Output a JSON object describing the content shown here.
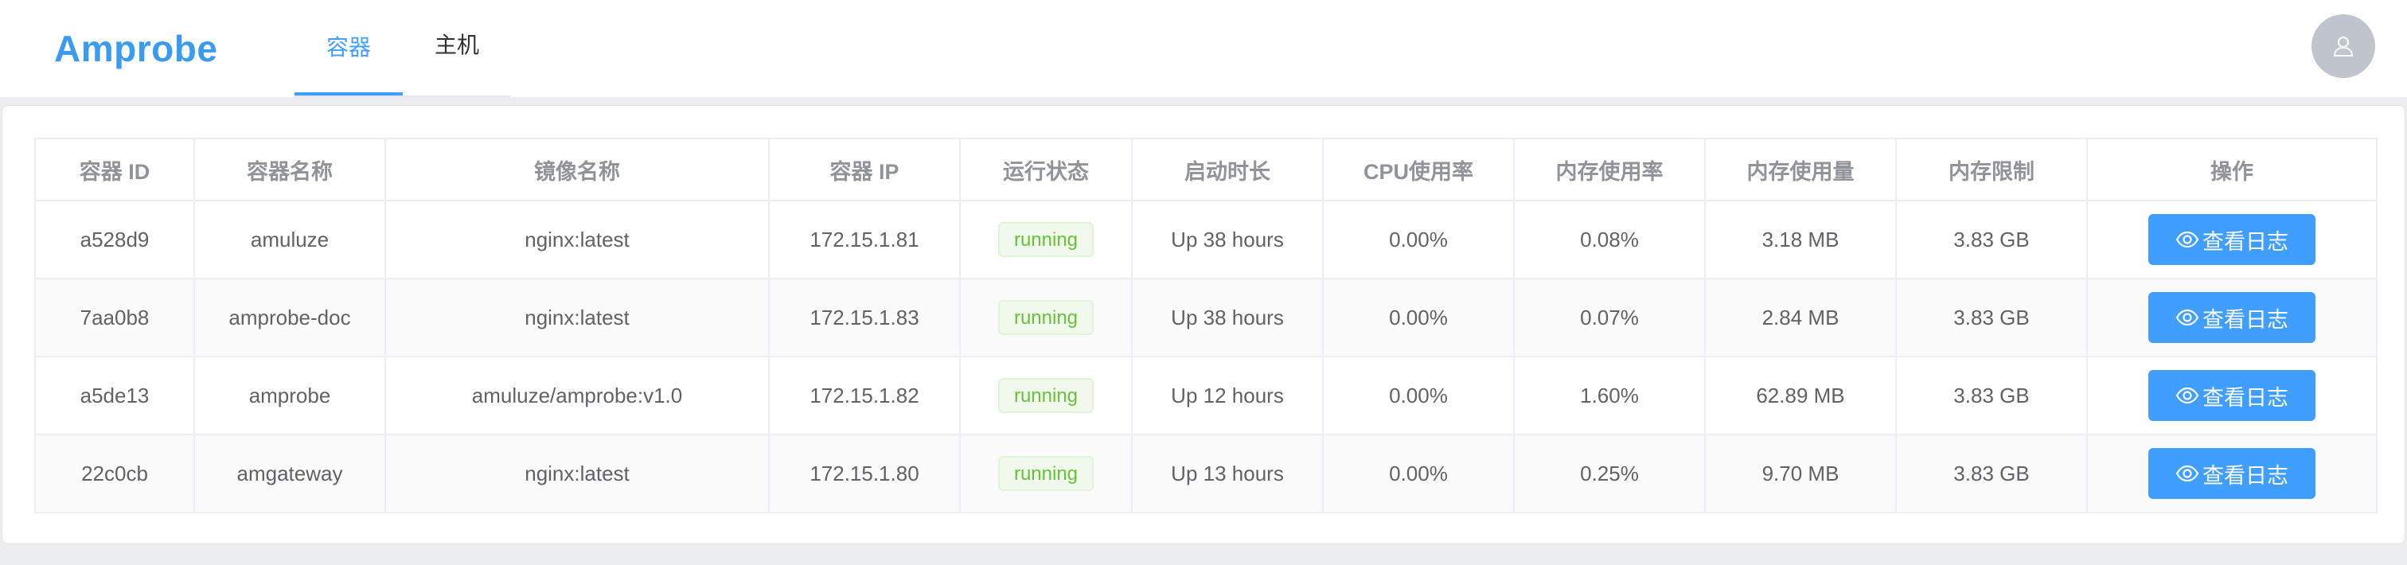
{
  "app": {
    "logo": "Amprobe"
  },
  "nav": {
    "tabs": [
      {
        "label": "容器",
        "active": true
      },
      {
        "label": "主机",
        "active": false
      }
    ]
  },
  "user": {
    "avatar_icon": "user-icon"
  },
  "table": {
    "headers": [
      "容器 ID",
      "容器名称",
      "镜像名称",
      "容器 IP",
      "运行状态",
      "启动时长",
      "CPU使用率",
      "内存使用率",
      "内存使用量",
      "内存限制",
      "操作"
    ],
    "rows": [
      {
        "id": "a528d9",
        "name": "amuluze",
        "image": "nginx:latest",
        "ip": "172.15.1.81",
        "status": "running",
        "uptime": "Up 38 hours",
        "cpu": "0.00%",
        "mem_pct": "0.08%",
        "mem_used": "3.18 MB",
        "mem_limit": "3.83 GB",
        "action": "查看日志"
      },
      {
        "id": "7aa0b8",
        "name": "amprobe-doc",
        "image": "nginx:latest",
        "ip": "172.15.1.83",
        "status": "running",
        "uptime": "Up 38 hours",
        "cpu": "0.00%",
        "mem_pct": "0.07%",
        "mem_used": "2.84 MB",
        "mem_limit": "3.83 GB",
        "action": "查看日志"
      },
      {
        "id": "a5de13",
        "name": "amprobe",
        "image": "amuluze/amprobe:v1.0",
        "ip": "172.15.1.82",
        "status": "running",
        "uptime": "Up 12 hours",
        "cpu": "0.00%",
        "mem_pct": "1.60%",
        "mem_used": "62.89 MB",
        "mem_limit": "3.83 GB",
        "action": "查看日志"
      },
      {
        "id": "22c0cb",
        "name": "amgateway",
        "image": "nginx:latest",
        "ip": "172.15.1.80",
        "status": "running",
        "uptime": "Up 13 hours",
        "cpu": "0.00%",
        "mem_pct": "0.25%",
        "mem_used": "9.70 MB",
        "mem_limit": "3.83 GB",
        "action": "查看日志"
      }
    ]
  },
  "colors": {
    "accent": "#409eff",
    "logo": "#3a9bf3",
    "status_running": "#67c23a",
    "avatar_bg": "#c0c4cc"
  },
  "icons": {
    "view": "eye-icon"
  }
}
